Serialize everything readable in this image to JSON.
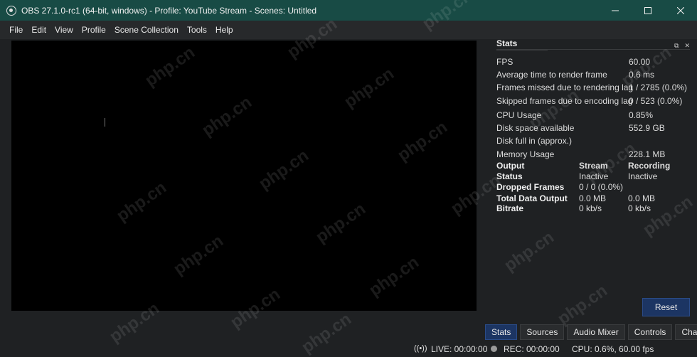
{
  "window": {
    "title": "OBS 27.1.0-rc1 (64-bit, windows) - Profile: YouTube Stream - Scenes: Untitled",
    "controls": [
      "minimize-icon",
      "maximize-icon",
      "close-icon"
    ]
  },
  "menu": [
    "File",
    "Edit",
    "View",
    "Profile",
    "Scene Collection",
    "Tools",
    "Help"
  ],
  "stats": {
    "title": "Stats",
    "rows": [
      {
        "label": "FPS",
        "value": "60.00"
      },
      {
        "label": "Average time to render frame",
        "value": "0.6 ms"
      },
      {
        "label": "Frames missed due to rendering lag",
        "value": "1 / 2785 (0.0%)"
      },
      {
        "label": "Skipped frames due to encoding lag",
        "value": "0 / 523 (0.0%)"
      },
      {
        "label": "CPU Usage",
        "value": "0.85%"
      },
      {
        "label": "Disk space available",
        "value": "552.9 GB"
      },
      {
        "label": "Disk full in (approx.)",
        "value": ""
      },
      {
        "label": "Memory Usage",
        "value": "228.1 MB"
      }
    ],
    "output": {
      "headers": [
        "Output",
        "Stream",
        "Recording"
      ],
      "rows": [
        {
          "label": "Status",
          "stream": "Inactive",
          "recording": "Inactive"
        },
        {
          "label": "Dropped Frames",
          "stream": "0 / 0 (0.0%)",
          "recording": ""
        },
        {
          "label": "Total Data Output",
          "stream": "0.0 MB",
          "recording": "0.0 MB"
        },
        {
          "label": "Bitrate",
          "stream": "0 kb/s",
          "recording": "0 kb/s"
        }
      ]
    },
    "reset_label": "Reset"
  },
  "dock_tabs": [
    {
      "label": "Stats",
      "active": true
    },
    {
      "label": "Sources",
      "active": false
    },
    {
      "label": "Audio Mixer",
      "active": false
    },
    {
      "label": "Controls",
      "active": false
    },
    {
      "label": "Chat",
      "active": false
    }
  ],
  "status_bar": {
    "live": "LIVE: 00:00:00",
    "rec": "REC: 00:00:00",
    "cpu": "CPU: 0.6%, 60.00 fps"
  },
  "watermark": "php.cn"
}
